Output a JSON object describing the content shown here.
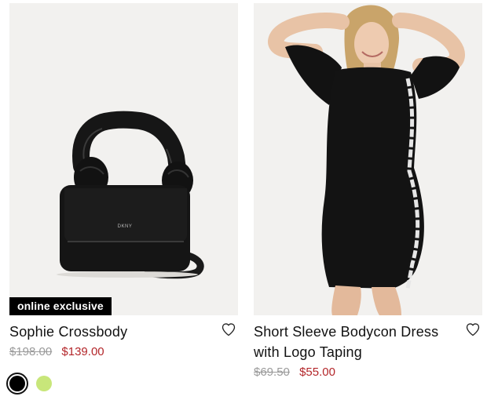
{
  "products": [
    {
      "badge": "online exclusive",
      "title": "Sophie Crossbody",
      "original_price": "$198.00",
      "sale_price": "$139.00",
      "image": "black-handbag",
      "swatches": [
        {
          "color": "#000000",
          "selected": true
        },
        {
          "color": "#c8e67a",
          "selected": false
        }
      ]
    },
    {
      "badge": "",
      "title": "Short Sleeve Bodycon Dress with Logo Taping",
      "original_price": "$69.50",
      "sale_price": "$55.00",
      "image": "woman-in-black-dress",
      "swatches": []
    }
  ],
  "colors": {
    "sale": "#b3262a",
    "strike": "#9a9a9a",
    "image_bg": "#f2f1ef"
  },
  "icons": {
    "wishlist": "heart-outline-icon"
  }
}
